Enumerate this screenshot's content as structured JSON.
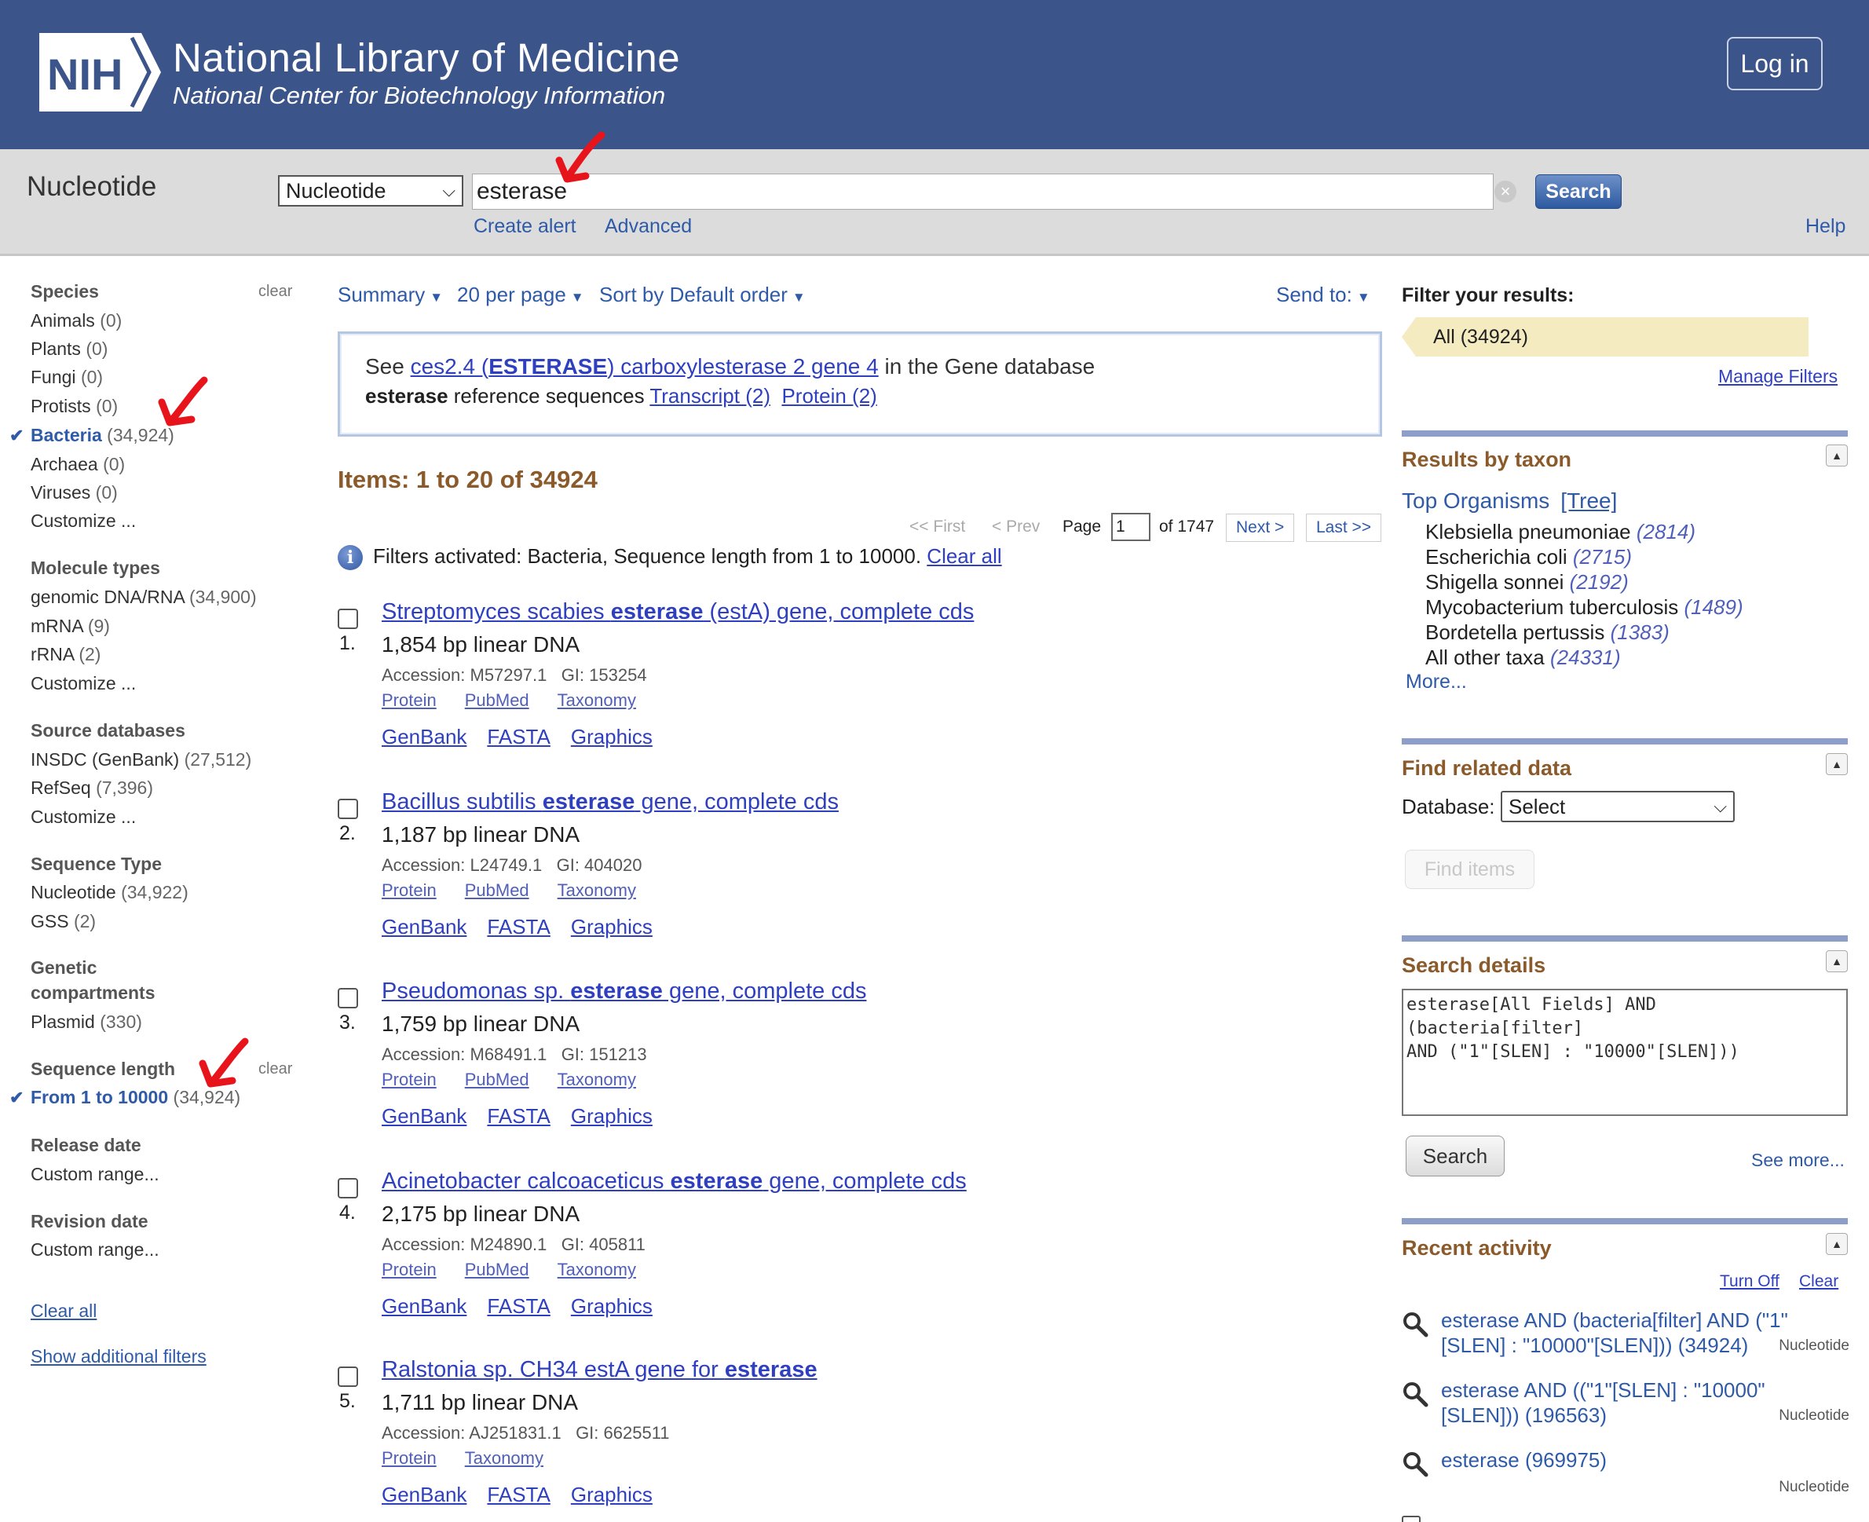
{
  "header": {
    "logo_text": "NIH",
    "title": "National Library of Medicine",
    "subtitle": "National Center for Biotechnology Information",
    "login_label": "Log in"
  },
  "search": {
    "db_name": "Nucleotide",
    "db_select": "Nucleotide",
    "term": "esterase",
    "search_label": "Search",
    "create_alert": "Create alert",
    "advanced": "Advanced",
    "help": "Help"
  },
  "left_filters": {
    "clear_label": "clear",
    "species": {
      "heading": "Species",
      "items": [
        {
          "label": "Animals",
          "count": "(0)"
        },
        {
          "label": "Plants",
          "count": "(0)"
        },
        {
          "label": "Fungi",
          "count": "(0)"
        },
        {
          "label": "Protists",
          "count": "(0)"
        },
        {
          "label": "Bacteria",
          "count": "(34,924)"
        },
        {
          "label": "Archaea",
          "count": "(0)"
        },
        {
          "label": "Viruses",
          "count": "(0)"
        }
      ],
      "customize": "Customize ..."
    },
    "molecule_types": {
      "heading": "Molecule types",
      "items": [
        {
          "label": "genomic DNA/RNA",
          "count": "(34,900)"
        },
        {
          "label": "mRNA",
          "count": "(9)"
        },
        {
          "label": "rRNA",
          "count": "(2)"
        }
      ],
      "customize": "Customize ..."
    },
    "source_databases": {
      "heading": "Source databases",
      "items": [
        {
          "label": "INSDC (GenBank)",
          "count": "(27,512)"
        },
        {
          "label": "RefSeq",
          "count": "(7,396)"
        }
      ],
      "customize": "Customize ..."
    },
    "sequence_type": {
      "heading": "Sequence Type",
      "items": [
        {
          "label": "Nucleotide",
          "count": "(34,922)"
        },
        {
          "label": "GSS",
          "count": "(2)"
        }
      ]
    },
    "genetic_compartments": {
      "heading_1": "Genetic",
      "heading_2": "compartments",
      "items": [
        {
          "label": "Plasmid",
          "count": "(330)"
        }
      ]
    },
    "sequence_length": {
      "heading": "Sequence length",
      "selected": {
        "label": "From 1 to 10000",
        "count": "(34,924)"
      }
    },
    "release_date": {
      "heading": "Release date",
      "custom": "Custom range..."
    },
    "revision_date": {
      "heading": "Revision date",
      "custom": "Custom range..."
    },
    "clear_all": "Clear all",
    "show_additional": "Show additional filters"
  },
  "display": {
    "summary": "Summary",
    "per_page": "20 per page",
    "sort": "Sort by Default order",
    "send_to": "Send to:"
  },
  "gene_box": {
    "see": "See",
    "gene_link_a": "ces2.4 (",
    "gene_link_b": "ESTERASE",
    "gene_link_c": ") carboxylesterase 2 gene 4",
    "in_gene_db": " in the Gene database",
    "refseq_term": "esterase",
    "refseq_text": " reference sequences ",
    "transcript": "Transcript (2)",
    "protein": "Protein (2)"
  },
  "items_count": "Items: 1 to 20 of 34924",
  "pager": {
    "first": "<< First",
    "prev": "< Prev",
    "page_label": "Page",
    "page_value": "1",
    "of": "of 1747",
    "next": "Next >",
    "last": "Last >>"
  },
  "filters_message": {
    "icon": "info-icon",
    "text": "Filters activated: Bacteria, Sequence length from 1 to 10000. ",
    "clear_all": "Clear all"
  },
  "results": [
    {
      "num": "1.",
      "title_pre": "Streptomyces scabies ",
      "title_bold": "esterase",
      "title_post": " (estA) gene, complete cds",
      "desc": "1,854 bp linear DNA",
      "accession": "Accession: M57297.1",
      "gi": "GI: 153254",
      "links1": [
        "Protein",
        "PubMed",
        "Taxonomy"
      ],
      "links2": [
        "GenBank",
        "FASTA",
        "Graphics"
      ]
    },
    {
      "num": "2.",
      "title_pre": "Bacillus subtilis ",
      "title_bold": "esterase",
      "title_post": " gene, complete cds",
      "desc": "1,187 bp linear DNA",
      "accession": "Accession: L24749.1",
      "gi": "GI: 404020",
      "links1": [
        "Protein",
        "PubMed",
        "Taxonomy"
      ],
      "links2": [
        "GenBank",
        "FASTA",
        "Graphics"
      ]
    },
    {
      "num": "3.",
      "title_pre": "Pseudomonas sp. ",
      "title_bold": "esterase",
      "title_post": " gene, complete cds",
      "desc": "1,759 bp linear DNA",
      "accession": "Accession: M68491.1",
      "gi": "GI: 151213",
      "links1": [
        "Protein",
        "PubMed",
        "Taxonomy"
      ],
      "links2": [
        "GenBank",
        "FASTA",
        "Graphics"
      ]
    },
    {
      "num": "4.",
      "title_pre": "Acinetobacter calcoaceticus ",
      "title_bold": "esterase",
      "title_post": " gene, complete cds",
      "desc": "2,175 bp linear DNA",
      "accession": "Accession: M24890.1",
      "gi": "GI: 405811",
      "links1": [
        "Protein",
        "PubMed",
        "Taxonomy"
      ],
      "links2": [
        "GenBank",
        "FASTA",
        "Graphics"
      ]
    },
    {
      "num": "5.",
      "title_pre": "Ralstonia sp. CH34 estA gene for ",
      "title_bold": "esterase",
      "title_post": "",
      "desc": "1,711 bp linear DNA",
      "accession": "Accession: AJ251831.1",
      "gi": "GI: 6625511",
      "links1": [
        "Protein",
        "Taxonomy"
      ],
      "links2": [
        "GenBank",
        "FASTA",
        "Graphics"
      ]
    }
  ],
  "right": {
    "filter_heading": "Filter your results:",
    "all_tab": "All (34924)",
    "manage_filters": "Manage Filters",
    "taxon": {
      "heading": "Results by taxon",
      "top_orgs": "Top Organisms",
      "tree": "[Tree]",
      "orgs": [
        {
          "name": "Klebsiella pneumoniae",
          "count": "(2814)"
        },
        {
          "name": "Escherichia coli",
          "count": "(2715)"
        },
        {
          "name": "Shigella sonnei",
          "count": "(2192)"
        },
        {
          "name": "Mycobacterium tuberculosis",
          "count": "(1489)"
        },
        {
          "name": "Bordetella pertussis",
          "count": "(1383)"
        },
        {
          "name": "All other taxa",
          "count": "(24331)"
        }
      ],
      "more": "More..."
    },
    "related": {
      "heading": "Find related data",
      "db_label": "Database:",
      "db_value": "Select",
      "find_items": "Find items"
    },
    "details": {
      "heading": "Search details",
      "query": "esterase[All Fields] AND (bacteria[filter]\nAND (\"1\"[SLEN] : \"10000\"[SLEN]))",
      "search": "Search",
      "see_more": "See more..."
    },
    "recent": {
      "heading": "Recent activity",
      "turn_off": "Turn Off",
      "clear": "Clear",
      "items": [
        {
          "text": "esterase AND (bacteria[filter] AND (\"1\"[SLEN] : \"10000\"[SLEN])) (34924)",
          "db": "Nucleotide"
        },
        {
          "text": "esterase AND ((\"1\"[SLEN] : \"10000\"[SLEN])) (196563)",
          "db": "Nucleotide"
        },
        {
          "text": "esterase (969975)",
          "db": "Nucleotide"
        }
      ]
    }
  },
  "colors": {
    "header_bg": "#3b5489",
    "link": "#2e3fbf",
    "section_heading": "#8b5a2b",
    "annotation_red": "#e8141c"
  }
}
